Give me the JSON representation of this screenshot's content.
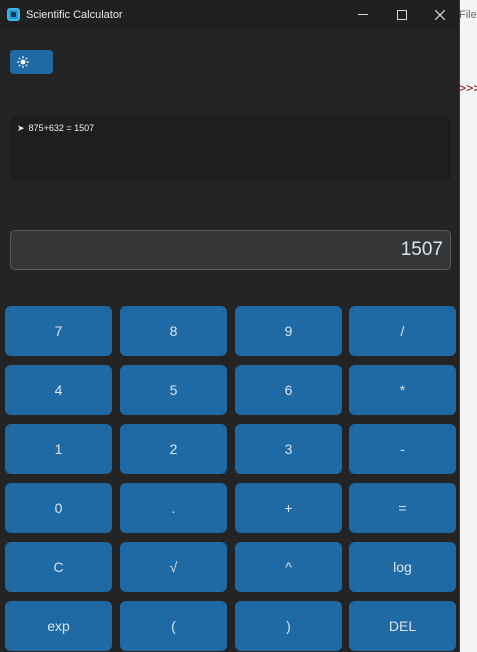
{
  "background": {
    "file_label": "File",
    "arrows": ">>>"
  },
  "window": {
    "title": "Scientific Calculator",
    "controls": {
      "minimize": "minimize",
      "maximize": "maximize",
      "close": "close"
    }
  },
  "theme_toggle": {
    "icon": "sun-icon"
  },
  "history": {
    "entries": [
      {
        "prefix": "➤",
        "text": "875+632 = 1507"
      }
    ]
  },
  "display": {
    "value": "1507"
  },
  "keypad": {
    "rows": [
      [
        "7",
        "8",
        "9",
        "/"
      ],
      [
        "4",
        "5",
        "6",
        "*"
      ],
      [
        "1",
        "2",
        "3",
        "-"
      ],
      [
        "0",
        ".",
        "+",
        "="
      ],
      [
        "C",
        "√",
        "^",
        "log"
      ],
      [
        "exp",
        "(",
        ")",
        "DEL"
      ]
    ]
  },
  "colors": {
    "button": "#1f6aa5",
    "window_bg": "#242424",
    "display_bg": "#343638",
    "history_bg": "#1d1e1e"
  }
}
